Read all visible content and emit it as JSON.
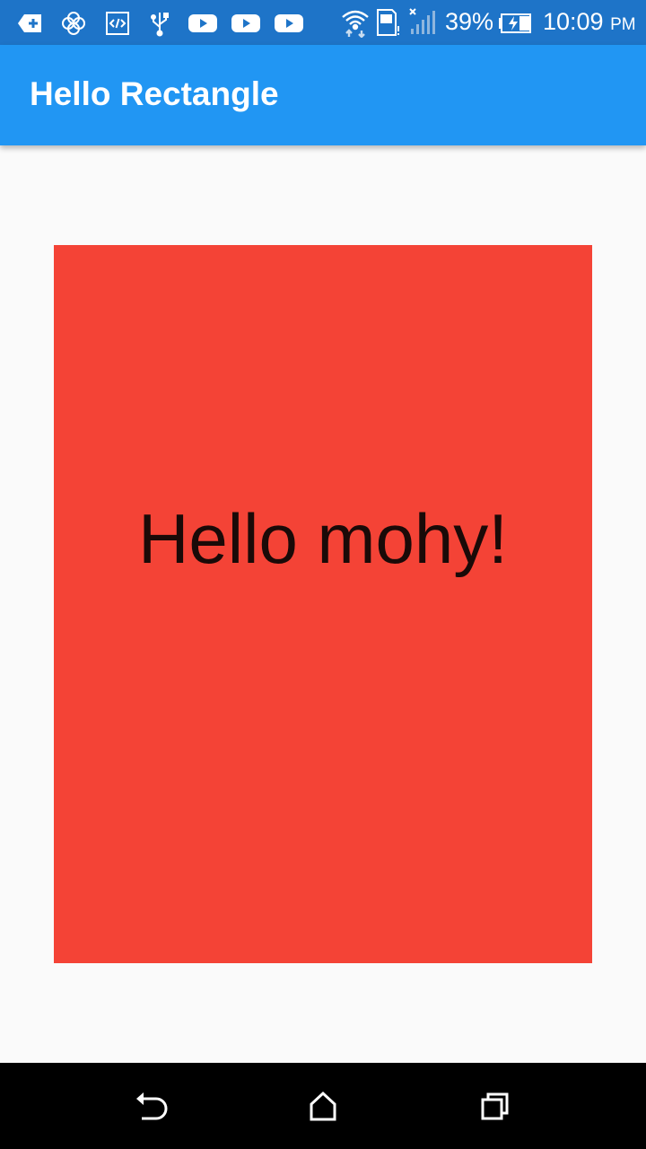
{
  "status_bar": {
    "left_icons": [
      "add-icon",
      "flower-icon",
      "code-icon",
      "usb-icon",
      "youtube-icon",
      "youtube-icon",
      "youtube-icon"
    ],
    "right_icons": [
      "wifi-icon",
      "sim-icon",
      "signal-icon",
      "battery-charging-icon"
    ],
    "battery_percent": "39%",
    "time": "10:09",
    "ampm": "PM"
  },
  "app_bar": {
    "title": "Hello Rectangle"
  },
  "main": {
    "rectangle_text": "Hello mohy!"
  },
  "nav_bar": {
    "buttons": [
      "back-icon",
      "home-icon",
      "recent-apps-icon"
    ]
  },
  "colors": {
    "status_bar": "#1e74c8",
    "app_bar": "#2196f3",
    "rectangle": "#f44336",
    "background": "#fafafa",
    "nav_bar": "#000000"
  }
}
